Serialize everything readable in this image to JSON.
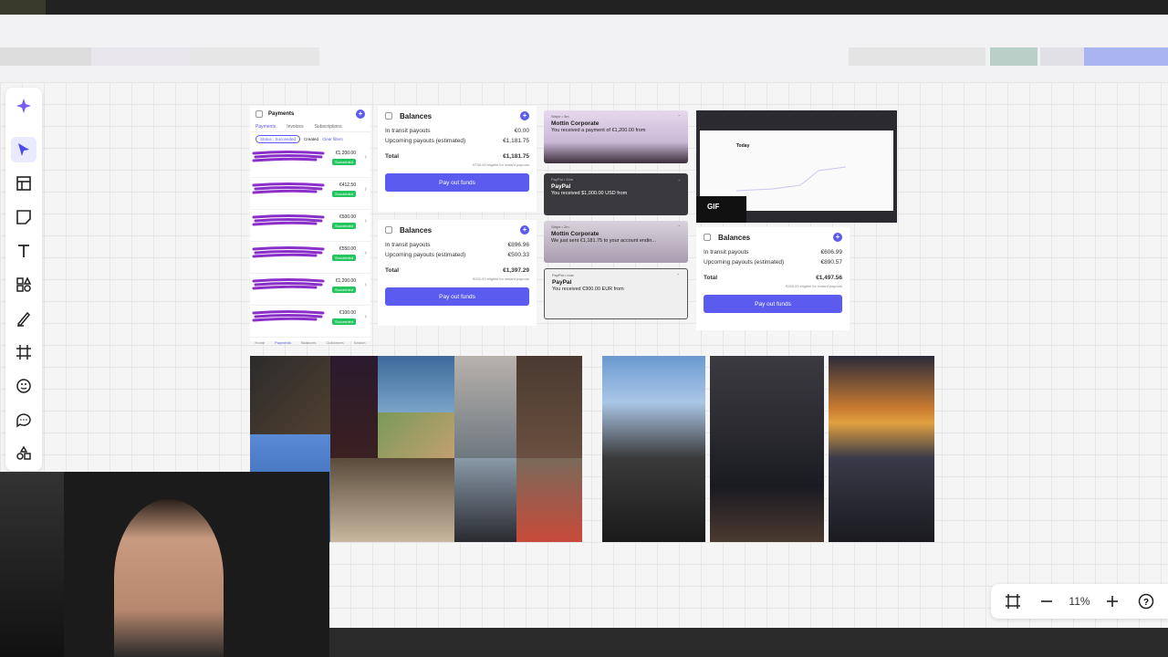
{
  "canvas": {
    "zoom_level": "11%"
  },
  "toolbar": {
    "tools": [
      {
        "name": "ai-sparkle-icon"
      },
      {
        "name": "select-cursor-icon",
        "active": true
      },
      {
        "name": "template-icon"
      },
      {
        "name": "sticky-note-icon"
      },
      {
        "name": "text-icon"
      },
      {
        "name": "shapes-icon"
      },
      {
        "name": "pen-icon"
      },
      {
        "name": "frame-icon"
      },
      {
        "name": "sticker-icon"
      },
      {
        "name": "comment-icon"
      },
      {
        "name": "more-tools-icon"
      }
    ]
  },
  "payments_card": {
    "title": "Payments",
    "tabs": [
      "Payments",
      "Invoices",
      "Subscriptions"
    ],
    "filter_chip": "Status : Succeeded",
    "filter_created": "Created",
    "filter_clear": "Clear filters",
    "rows": [
      {
        "amount": "€1,200.00",
        "status": "Succeeded"
      },
      {
        "amount": "€412.50",
        "status": "Succeeded"
      },
      {
        "amount": "€500.00",
        "status": "Succeeded"
      },
      {
        "amount": "€550.00",
        "status": "Succeeded"
      },
      {
        "amount": "€1,200.00",
        "status": "Succeeded"
      },
      {
        "amount": "€100.00",
        "status": "Succeeded"
      }
    ],
    "bottom_nav": [
      "Home",
      "Payments",
      "Balances",
      "Customers",
      "Search"
    ]
  },
  "balances_1": {
    "title": "Balances",
    "in_transit_label": "In transit payouts",
    "in_transit_value": "€0.00",
    "upcoming_label": "Upcoming payouts (estimated)",
    "upcoming_value": "€1,181.75",
    "total_label": "Total",
    "total_value": "€1,181.75",
    "note": "€750.00 eligible for instant payouts",
    "button": "Pay out funds"
  },
  "balances_2": {
    "title": "Balances",
    "in_transit_label": "In transit payouts",
    "in_transit_value": "€896.96",
    "upcoming_label": "Upcoming payouts (estimated)",
    "upcoming_value": "€500.33",
    "total_label": "Total",
    "total_value": "€1,397.29",
    "note": "€200.00 eligible for instant payouts",
    "button": "Pay out funds"
  },
  "balances_3": {
    "title": "Balances",
    "in_transit_label": "In transit payouts",
    "in_transit_value": "€606.99",
    "upcoming_label": "Upcoming payouts (estimated)",
    "upcoming_value": "€890.57",
    "total_label": "Total",
    "total_value": "€1,497.56",
    "note": "€200.00 eligible for instant payouts",
    "button": "Pay out funds"
  },
  "notifications": [
    {
      "app": "Stripe • 5m",
      "title": "Mottin Corporate",
      "body": "You received a payment of €1,200.00 from"
    },
    {
      "app": "PayPal • 34m",
      "title": "PayPal",
      "body": "You received $1,000.00 USD from"
    },
    {
      "app": "Stripe • 2m",
      "title": "Mottin Corporate",
      "body": "We just sent €1,181.75 to your account endin..."
    },
    {
      "app": "PayPal • now",
      "title": "PayPal",
      "body": "You received €300.00 EUR from"
    }
  ],
  "dashboard_thumb": {
    "heading": "Today",
    "gif_label": "GIF"
  },
  "colors": {
    "accent": "#5b5bf0",
    "success": "#22c55e",
    "scribble": "#8b2fc9"
  }
}
